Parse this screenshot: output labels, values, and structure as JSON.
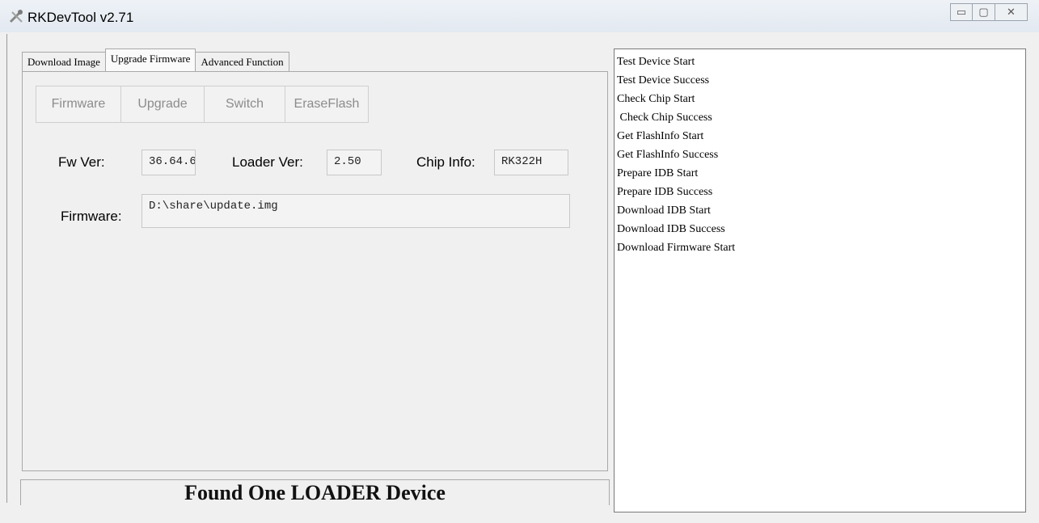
{
  "window": {
    "title": "RKDevTool v2.71",
    "controls": {
      "minimize": "▭",
      "maximize": "▢",
      "close": "✕"
    }
  },
  "tabs": [
    {
      "label": "Download Image",
      "active": false
    },
    {
      "label": "Upgrade Firmware",
      "active": true
    },
    {
      "label": "Advanced Function",
      "active": false
    }
  ],
  "toolbar": {
    "firmware_label": "Firmware",
    "upgrade_label": "Upgrade",
    "switch_label": "Switch",
    "eraseflash_label": "EraseFlash"
  },
  "info": {
    "fw_ver_label": "Fw Ver:",
    "fw_ver_value": "36.64.6",
    "loader_ver_label": "Loader Ver:",
    "loader_ver_value": "2.50",
    "chip_info_label": "Chip Info:",
    "chip_info_value": "RK322H",
    "firmware_label": "Firmware:",
    "firmware_path": "D:\\share\\update.img"
  },
  "status": {
    "text": "Found One LOADER Device"
  },
  "log": {
    "lines": [
      "Test Device Start",
      "Test Device Success",
      "Check Chip Start",
      " Check Chip Success",
      "Get FlashInfo Start",
      "Get FlashInfo Success",
      "Prepare IDB Start",
      "Prepare IDB Success",
      "Download IDB Start",
      "Download IDB Success",
      "Download Firmware Start"
    ]
  },
  "icons": {
    "app": "rk-tool-icon"
  }
}
